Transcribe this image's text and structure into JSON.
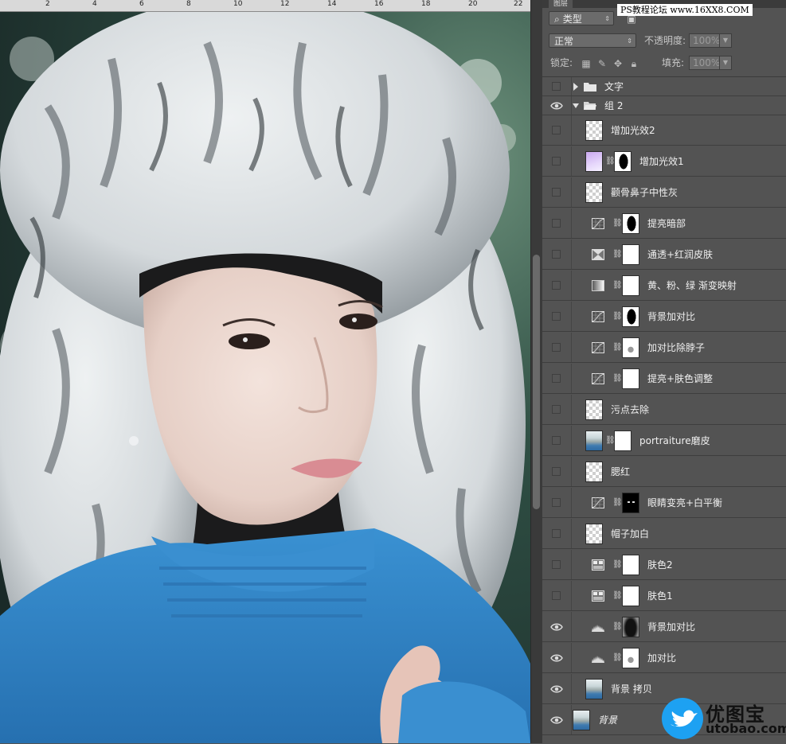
{
  "ruler": {
    "marks": [
      "2",
      "4",
      "6",
      "8",
      "10",
      "12",
      "14",
      "16",
      "18",
      "20",
      "22"
    ]
  },
  "panel": {
    "tab": "图层",
    "site_badge": "PS教程论坛 www.16XX8.COM",
    "filter_kind": "类型",
    "blend_mode": "正常",
    "opacity_label": "不透明度:",
    "opacity_value": "100%",
    "lock_label": "锁定:",
    "fill_label": "填充:",
    "fill_value": "100%"
  },
  "layers": [
    {
      "name": "文字",
      "kind": "group",
      "visible": false,
      "expanded": false
    },
    {
      "name": "组 2",
      "kind": "group",
      "visible": true,
      "expanded": true
    },
    {
      "name": "增加光效2",
      "kind": "pixel",
      "visible": false
    },
    {
      "name": "增加光效1",
      "kind": "pixel-mask",
      "visible": false
    },
    {
      "name": "颧骨鼻子中性灰",
      "kind": "pixel",
      "visible": false
    },
    {
      "name": "提亮暗部",
      "kind": "curves",
      "visible": false
    },
    {
      "name": "通透+红润皮肤",
      "kind": "channel-mixer",
      "visible": false
    },
    {
      "name": "黄、粉、绿 渐变映射",
      "kind": "gradient-map",
      "visible": false
    },
    {
      "name": "背景加对比",
      "kind": "curves",
      "visible": false
    },
    {
      "name": "加对比除脖子",
      "kind": "curves",
      "visible": false
    },
    {
      "name": "提亮+肤色调整",
      "kind": "curves",
      "visible": false
    },
    {
      "name": "污点去除",
      "kind": "pixel",
      "visible": false
    },
    {
      "name": "portraiture磨皮",
      "kind": "photo-mask",
      "visible": false
    },
    {
      "name": "腮红",
      "kind": "pixel",
      "visible": false
    },
    {
      "name": "眼睛变亮+白平衡",
      "kind": "curves",
      "visible": false
    },
    {
      "name": "帽子加白",
      "kind": "pixel",
      "visible": false
    },
    {
      "name": "肤色2",
      "kind": "selective-color",
      "visible": false
    },
    {
      "name": "肤色1",
      "kind": "selective-color",
      "visible": false
    },
    {
      "name": "背景加对比",
      "kind": "levels",
      "visible": true
    },
    {
      "name": "加对比",
      "kind": "levels",
      "visible": true
    },
    {
      "name": "背景 拷贝",
      "kind": "photo",
      "visible": true
    },
    {
      "name": "背景",
      "kind": "photo",
      "visible": true,
      "italic": true
    }
  ],
  "watermark": {
    "brand": "优图宝",
    "url": "utobao.com"
  },
  "colors": {
    "panel_bg": "#535353",
    "sweater_blue": "#2f82c4",
    "watermark_bird": "#1da1f2"
  }
}
